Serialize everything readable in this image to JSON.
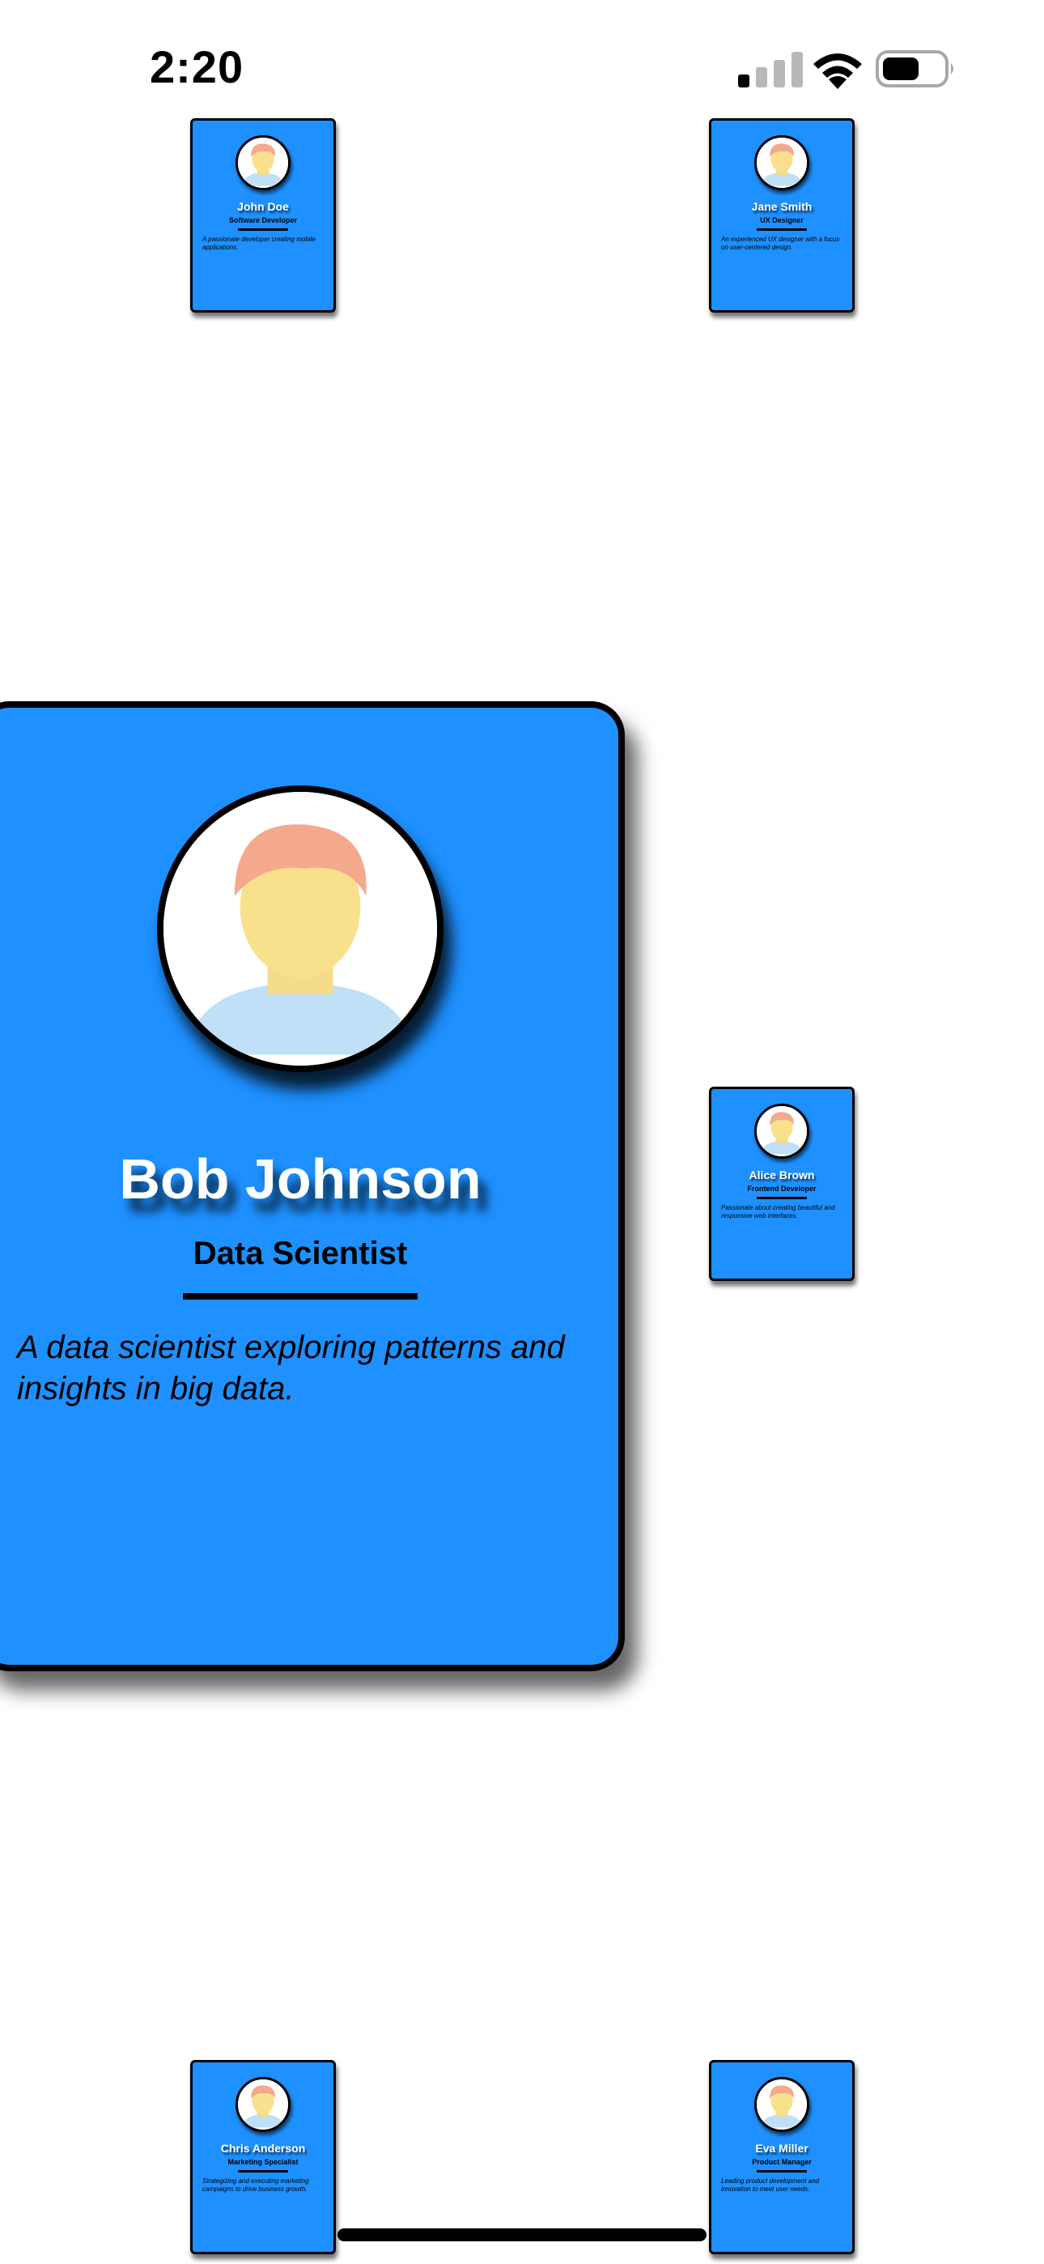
{
  "status_bar": {
    "time": "2:20",
    "signal_icon": "cellular-signal-icon",
    "wifi_icon": "wifi-icon",
    "battery_icon": "battery-icon"
  },
  "colors": {
    "card_background": "#1e90ff",
    "card_border": "#000000",
    "name_text": "#ffffff"
  },
  "cards": [
    {
      "name": "John Doe",
      "role": "Software Developer",
      "bio": "A passionate developer creating mobile applications.",
      "icon": "user-avatar-icon"
    },
    {
      "name": "Jane Smith",
      "role": "UX Designer",
      "bio": "An experienced UX designer with a focus on user-centered design.",
      "icon": "user-avatar-icon"
    },
    {
      "name": "Bob Johnson",
      "role": "Data Scientist",
      "bio": "A data scientist exploring patterns and insights in big data.",
      "icon": "user-avatar-icon"
    },
    {
      "name": "Alice Brown",
      "role": "Frontend Developer",
      "bio": "Passionate about creating beautiful and responsive web interfaces.",
      "icon": "user-avatar-icon"
    },
    {
      "name": "Chris Anderson",
      "role": "Marketing Specialist",
      "bio": "Strategizing and executing marketing campaigns to drive business growth.",
      "icon": "user-avatar-icon"
    },
    {
      "name": "Eva Miller",
      "role": "Product Manager",
      "bio": "Leading product development and innovation to meet user needs.",
      "icon": "user-avatar-icon"
    }
  ]
}
